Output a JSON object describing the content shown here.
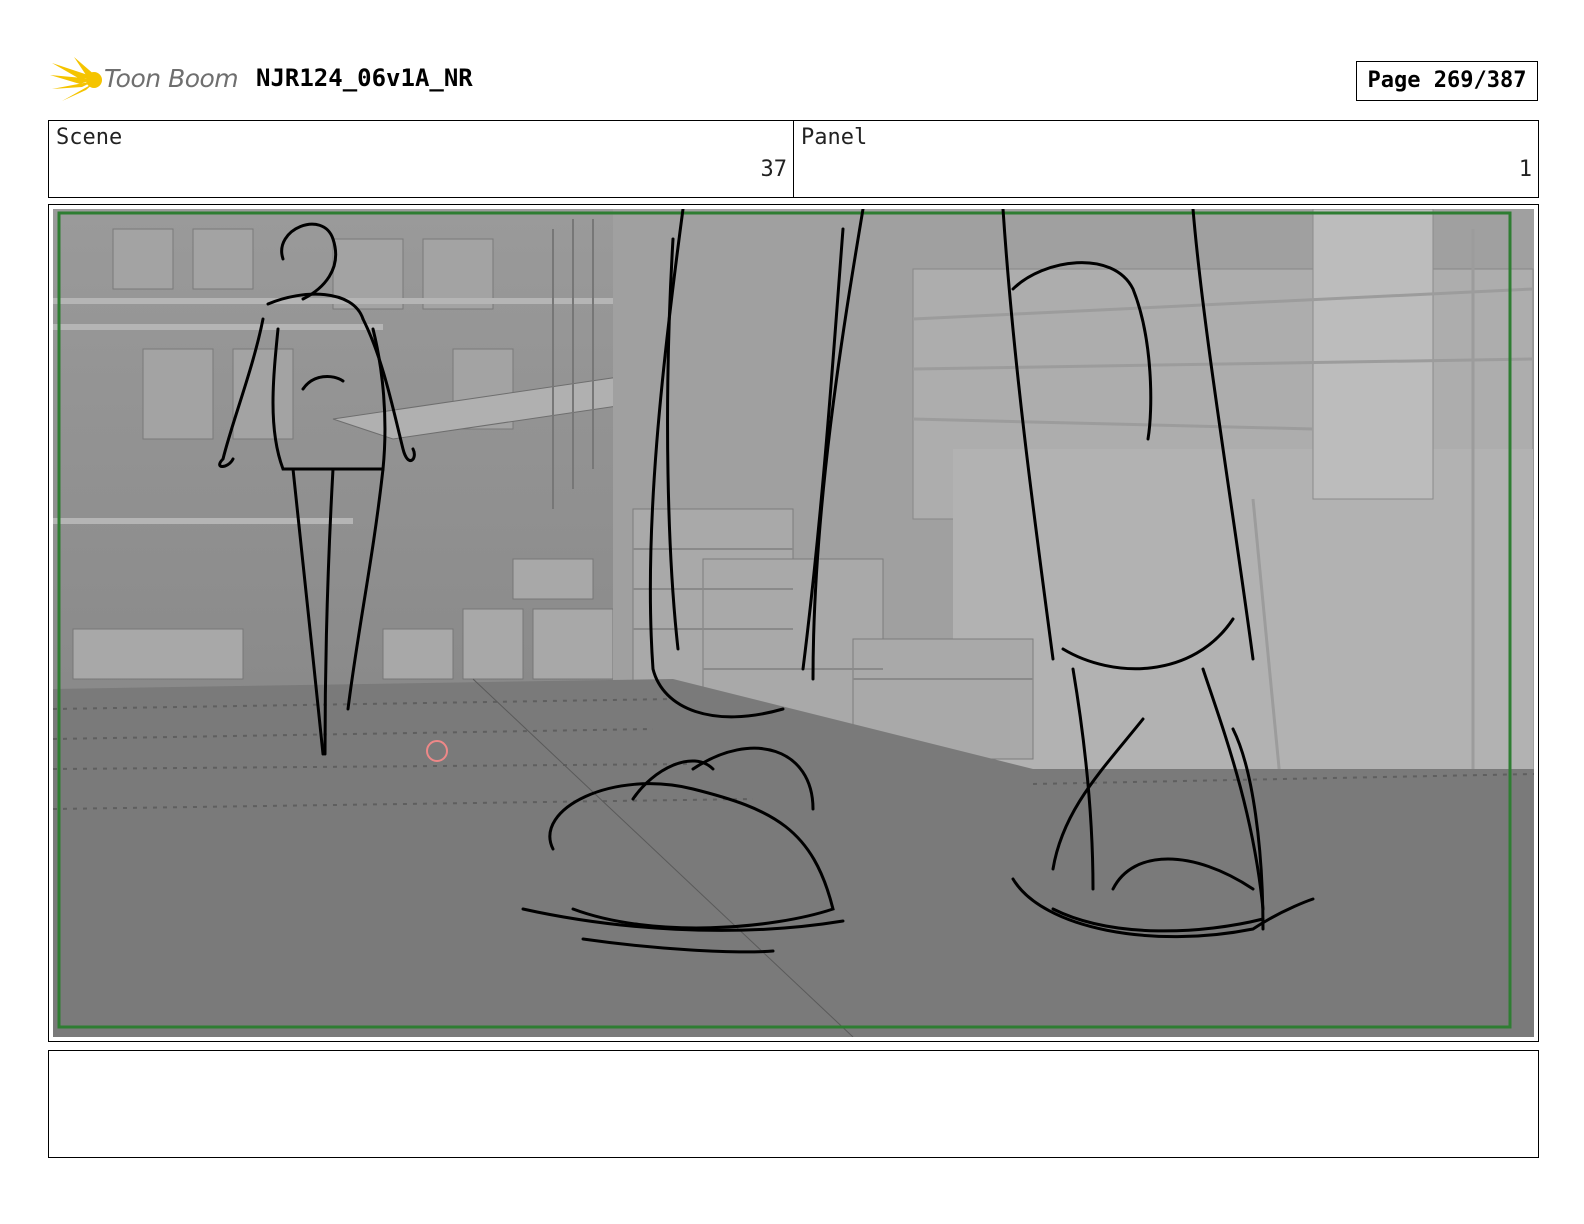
{
  "header": {
    "logo_text": "Toon Boom",
    "project_title": "NJR124_06v1A_NR",
    "page_label": "Page 269/387"
  },
  "info": {
    "scene_label": "Scene",
    "scene_value": "37",
    "panel_label": "Panel",
    "panel_value": "1"
  },
  "colors": {
    "logo_yellow": "#f5c400",
    "frame_green": "#2e7d32",
    "sketch_line": "#000000"
  },
  "notes": ""
}
